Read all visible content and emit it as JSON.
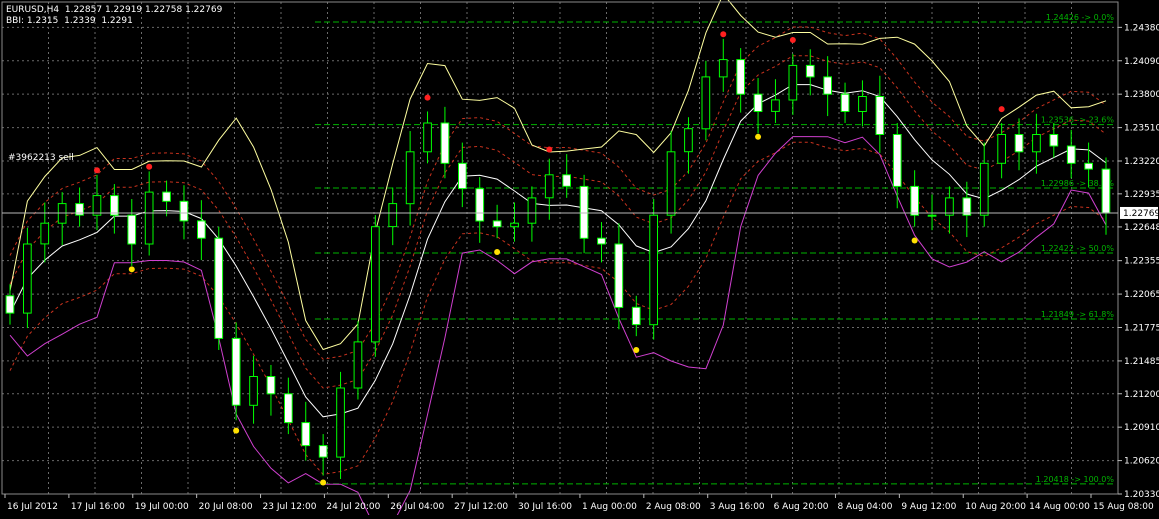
{
  "header": {
    "symbol": "EURUSD,H4",
    "ohlc": "1.22857 1.22919 1.22758 1.22769",
    "indicator": "BBI: 1.2315  1.2339  1.2291"
  },
  "order_label": "#3962213 sell",
  "colors": {
    "background": "#000000",
    "grid": "#6a6a6a",
    "candle": "#00ff00",
    "candle_bull_fill": "#000000",
    "candle_bear_fill": "#ffffff",
    "bb_outer": "#ffffa0",
    "bb_mid": "#ffffff",
    "bb_lower": "#d040d0",
    "env": "#c8321e",
    "fib": "#00b400",
    "fractal_up": "#ff2020",
    "fractal_down": "#ffe000",
    "price_axis_text": "#ffffff"
  },
  "chart_data": {
    "type": "candlestick",
    "symbol": "EURUSD",
    "timeframe": "H4",
    "ylim": [
      1.2033,
      1.246
    ],
    "y_ticks": [
      "1.24380",
      "1.24090",
      "1.23800",
      "1.23510",
      "1.23220",
      "1.22935",
      "1.22648",
      "1.22355",
      "1.22065",
      "1.21775",
      "1.21485",
      "1.21200",
      "1.20910",
      "1.20620",
      "1.20330"
    ],
    "x_ticks": [
      "16 Jul 2012",
      "17 Jul 16:00",
      "19 Jul 00:00",
      "20 Jul 08:00",
      "23 Jul 12:00",
      "24 Jul 20:00",
      "26 Jul 04:00",
      "27 Jul 12:00",
      "30 Jul 16:00",
      "1 Aug 00:00",
      "2 Aug 08:00",
      "3 Aug 16:00",
      "6 Aug 20:00",
      "8 Aug 04:00",
      "9 Aug 12:00",
      "10 Aug 20:00",
      "14 Aug 00:00",
      "15 Aug 08:00"
    ],
    "current_price": "1.22769",
    "fib_levels": [
      {
        "label": "1.24426 -> 0.0%",
        "value": 1.24426
      },
      {
        "label": "1.23536 -> 23.6%",
        "value": 1.23536
      },
      {
        "label": "1.22986 -> 38.2%",
        "value": 1.22986
      },
      {
        "label": "1.22422 -> 50.0%",
        "value": 1.22422
      },
      {
        "label": "1.21849 -> 61.8%",
        "value": 1.21849
      },
      {
        "label": "1.20418 -> 100.0%",
        "value": 1.20418
      }
    ],
    "series": [
      {
        "name": "Close",
        "values": [
          1.219,
          1.225,
          1.2268,
          1.2285,
          1.2275,
          1.2292,
          1.2275,
          1.225,
          1.2295,
          1.2287,
          1.227,
          1.2255,
          1.2168,
          1.211,
          1.2135,
          1.212,
          1.2095,
          1.2075,
          1.2065,
          1.2125,
          1.2165,
          1.2265,
          1.2285,
          1.233,
          1.2355,
          1.232,
          1.2298,
          1.227,
          1.2265,
          1.2268,
          1.229,
          1.231,
          1.23,
          1.2255,
          1.225,
          1.2195,
          1.218,
          1.2275,
          1.233,
          1.235,
          1.2395,
          1.241,
          1.238,
          1.2365,
          1.2375,
          1.2405,
          1.2395,
          1.238,
          1.2365,
          1.2378,
          1.2345,
          1.23,
          1.2275,
          1.2275,
          1.229,
          1.2275,
          1.232,
          1.2345,
          1.233,
          1.2345,
          1.2335,
          1.232,
          1.2315,
          1.2277
        ]
      }
    ]
  }
}
